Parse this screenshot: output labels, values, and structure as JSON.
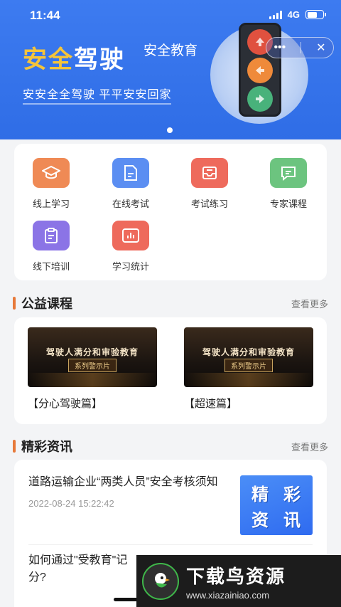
{
  "status": {
    "time": "11:44",
    "network": "4G"
  },
  "banner": {
    "title_part1": "安全",
    "title_part2": "驾驶",
    "subtitle": "安全教育",
    "slogan": "安安全全驾驶  平平安安回家"
  },
  "capsule": {
    "more": "•••",
    "close": "✕"
  },
  "grid": {
    "items": [
      {
        "label": "线上学习",
        "icon": "graduation-cap-icon",
        "color": "#ef8a55"
      },
      {
        "label": "在线考试",
        "icon": "document-edit-icon",
        "color": "#5b8ef2"
      },
      {
        "label": "考试练习",
        "icon": "inbox-icon",
        "color": "#ee6a5c"
      },
      {
        "label": "专家课程",
        "icon": "chat-bubble-icon",
        "color": "#6cc47f"
      },
      {
        "label": "线下培训",
        "icon": "clipboard-icon",
        "color": "#8b74e6"
      },
      {
        "label": "学习统计",
        "icon": "bar-chart-icon",
        "color": "#ee6a5c"
      }
    ]
  },
  "courses_section": {
    "title": "公益课程",
    "more": "查看更多"
  },
  "courses": [
    {
      "thumb_title": "驾驶人满分和审验教育",
      "thumb_tag": "系列警示片",
      "name": "【分心驾驶篇】"
    },
    {
      "thumb_title": "驾驶人满分和审验教育",
      "thumb_tag": "系列警示片",
      "name": "【超速篇】"
    }
  ],
  "news_section": {
    "title": "精彩资讯",
    "more": "查看更多"
  },
  "news": [
    {
      "title": "道路运输企业“两类人员”安全考核须知",
      "date": "2022-08-24 15:22:42",
      "thumb": [
        "精",
        "彩",
        "资",
        "讯"
      ]
    },
    {
      "title": "如何通过\"受教育\"记分?",
      "date": "",
      "thumb": []
    }
  ],
  "watermark": {
    "name": "下载鸟资源",
    "url": "www.xiazainiao.com"
  }
}
